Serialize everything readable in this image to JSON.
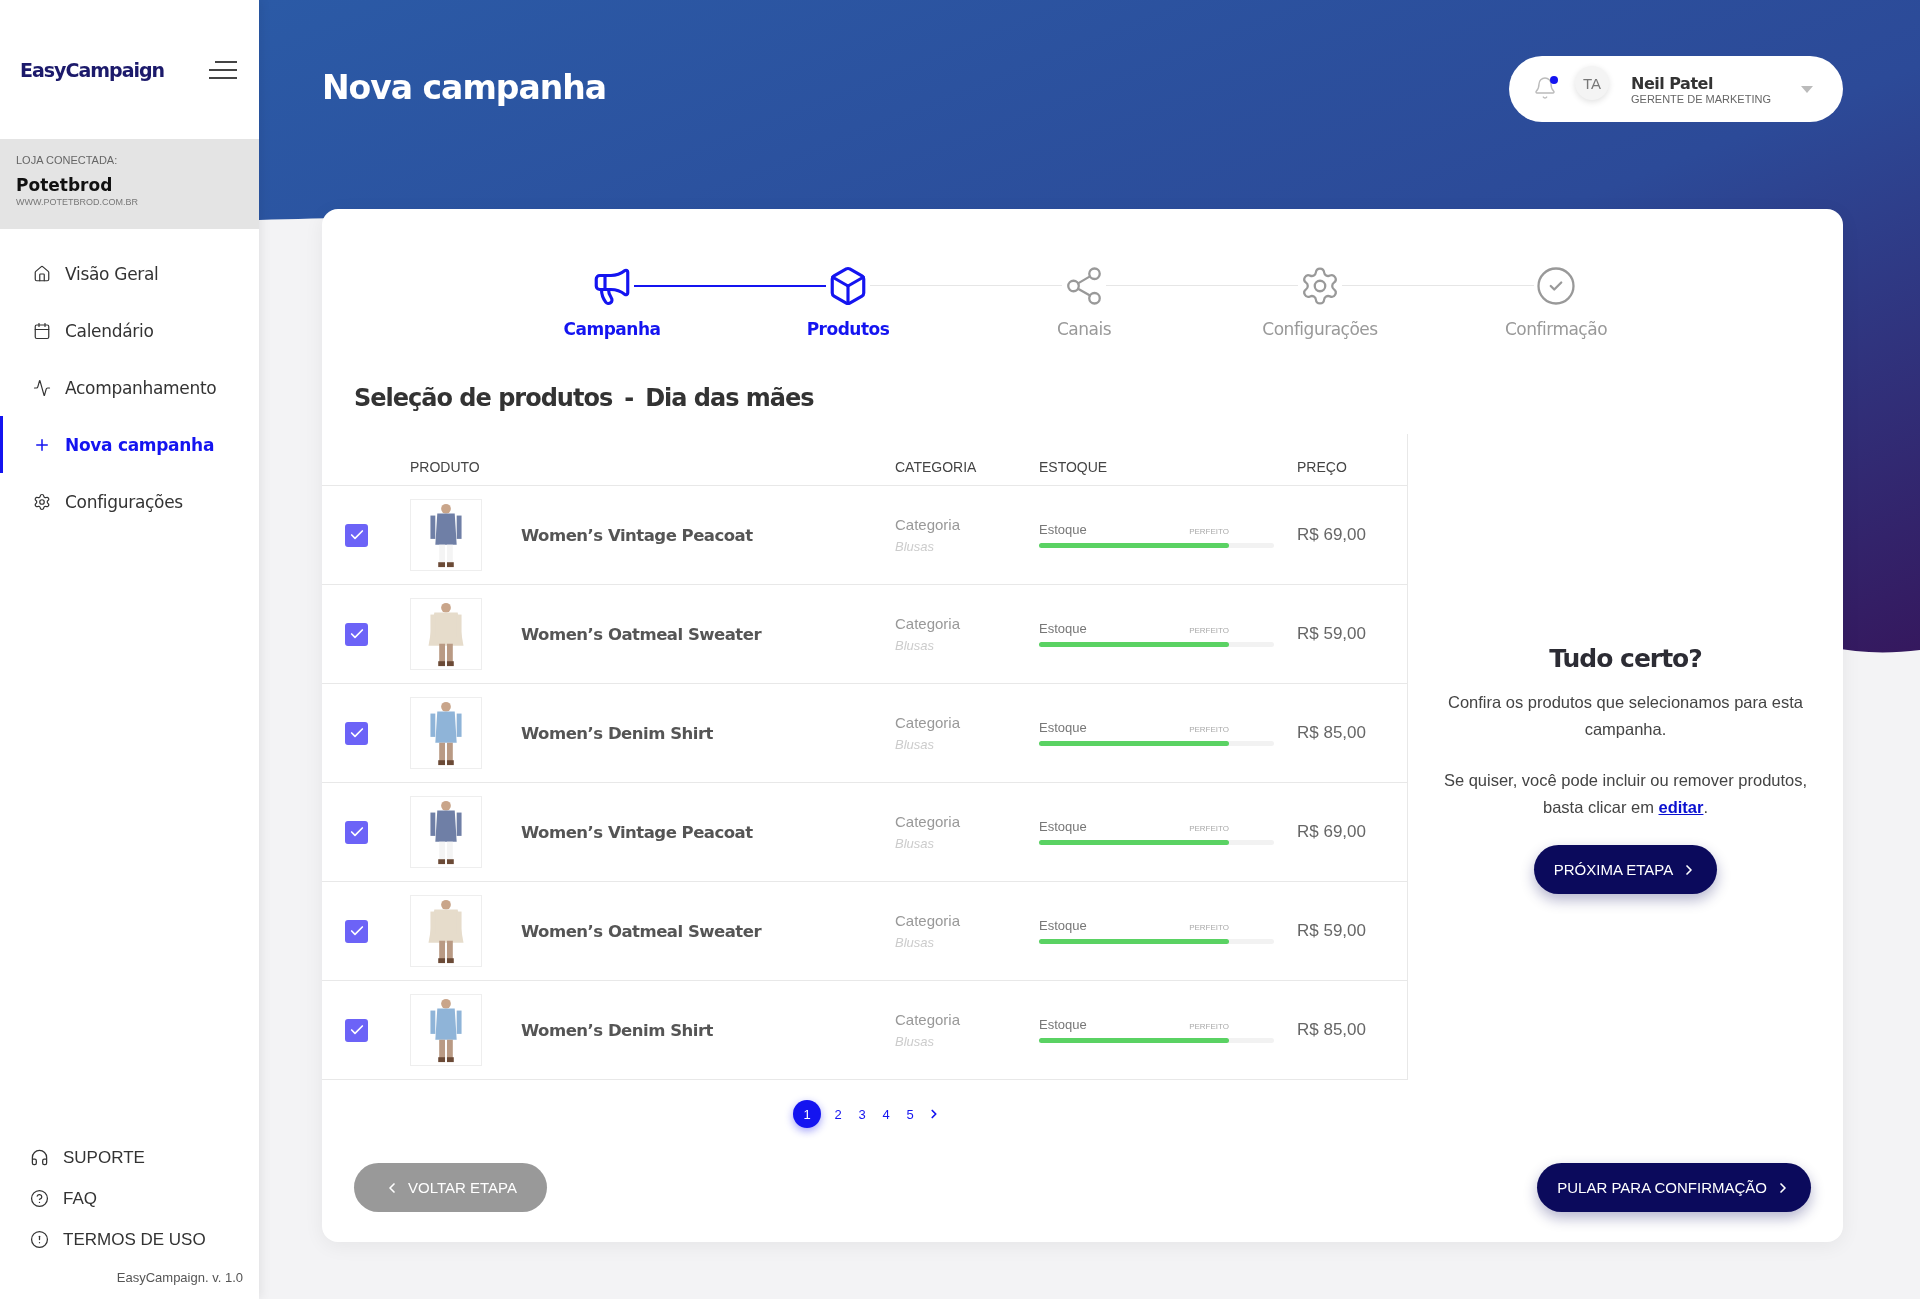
{
  "sidebar": {
    "logo": "EasyCampaign",
    "store": {
      "caption": "LOJA CONECTADA:",
      "name": "Potetbrod",
      "url": "WWW.POTETBROD.COM.BR"
    },
    "nav": [
      {
        "label": "Visão Geral",
        "selected": false
      },
      {
        "label": "Calendário",
        "selected": false
      },
      {
        "label": "Acompanhamento",
        "selected": false
      },
      {
        "label": "Nova campanha",
        "selected": true
      },
      {
        "label": "Configurações",
        "selected": false
      }
    ],
    "footer_links": [
      "SUPORTE",
      "FAQ",
      "TERMOS DE USO"
    ],
    "version": "EasyCampaign. v. 1.0"
  },
  "header": {
    "title": "Nova campanha",
    "user": {
      "initials": "TA",
      "name": "Neil Patel",
      "role": "GERENTE DE MARKETING",
      "has_notification": true
    }
  },
  "stepper": [
    {
      "label": "Campanha",
      "active": true
    },
    {
      "label": "Produtos",
      "active": true
    },
    {
      "label": "Canais",
      "active": false
    },
    {
      "label": "Configurações",
      "active": false
    },
    {
      "label": "Confirmação",
      "active": false
    }
  ],
  "section_title": {
    "main": "Seleção de produtos",
    "separator": "-",
    "sub": "Dia das mães"
  },
  "table": {
    "columns": [
      "PRODUTO",
      "CATEGORIA",
      "ESTOQUE",
      "PREÇO"
    ],
    "rows": [
      {
        "checked": true,
        "name": "Women’s Vintage Peacoat",
        "category": "Categoria",
        "subcategory": "Blusas",
        "stock_label": "Estoque",
        "stock_status": "PERFEITO",
        "level": 0.81,
        "price": "R$ 69,00"
      },
      {
        "checked": true,
        "name": "Women’s Oatmeal Sweater",
        "category": "Categoria",
        "subcategory": "Blusas",
        "stock_label": "Estoque",
        "stock_status": "PERFEITO",
        "level": 0.81,
        "price": "R$ 59,00"
      },
      {
        "checked": true,
        "name": "Women’s Denim Shirt",
        "category": "Categoria",
        "subcategory": "Blusas",
        "stock_label": "Estoque",
        "stock_status": "PERFEITO",
        "level": 0.81,
        "price": "R$ 85,00"
      },
      {
        "checked": true,
        "name": "Women’s Vintage Peacoat",
        "category": "Categoria",
        "subcategory": "Blusas",
        "stock_label": "Estoque",
        "stock_status": "PERFEITO",
        "level": 0.81,
        "price": "R$ 69,00"
      },
      {
        "checked": true,
        "name": "Women’s Oatmeal Sweater",
        "category": "Categoria",
        "subcategory": "Blusas",
        "stock_label": "Estoque",
        "stock_status": "PERFEITO",
        "level": 0.81,
        "price": "R$ 59,00"
      },
      {
        "checked": true,
        "name": "Women’s Denim Shirt",
        "category": "Categoria",
        "subcategory": "Blusas",
        "stock_label": "Estoque",
        "stock_status": "PERFEITO",
        "level": 0.81,
        "price": "R$ 85,00"
      }
    ]
  },
  "summary": {
    "title": "Tudo certo?",
    "text_1": "Confira os produtos que selecionamos para esta campanha.",
    "text_2": "Se quiser, você pode incluir ou remover produtos, basta clicar em",
    "link": "editar",
    "text_2_end": ".",
    "button": "PRÓXIMA ETAPA"
  },
  "pagination": {
    "pages": [
      {
        "label": "1",
        "selected": true
      },
      {
        "label": "2",
        "selected": false
      },
      {
        "label": "3",
        "selected": false
      },
      {
        "label": "4",
        "selected": false
      },
      {
        "label": "5",
        "selected": false
      }
    ]
  },
  "buttons": {
    "back": "VOLTAR ETAPA",
    "skip": "PULAR PARA CONFIRMAÇÃO"
  }
}
